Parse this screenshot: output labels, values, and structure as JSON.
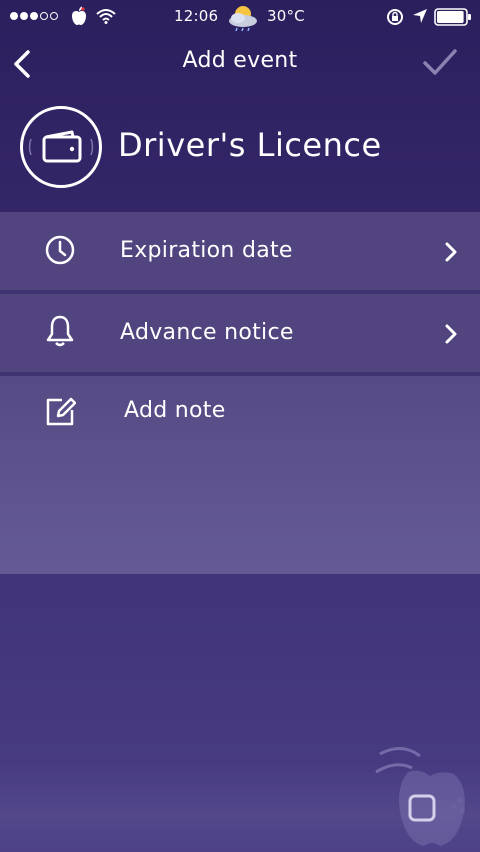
{
  "status_bar": {
    "time": "12:06",
    "temperature": "30°C",
    "signal_dots_filled": 3,
    "signal_dots_total": 5,
    "battery_level": 0.95,
    "icons": [
      "apple-icon",
      "wifi-icon",
      "weather-icon",
      "rotation-lock-icon",
      "location-arrow-icon",
      "battery-icon"
    ]
  },
  "nav": {
    "title": "Add event",
    "back_icon": "chevron-left-icon",
    "done_icon": "checkmark-icon"
  },
  "header": {
    "title": "Driver's Licence",
    "icon": "wallet-icon"
  },
  "rows": [
    {
      "label": "Expiration date",
      "icon": "clock-icon",
      "chevron": true
    },
    {
      "label": "Advance notice",
      "icon": "bell-icon",
      "chevron": true
    },
    {
      "label": "Add note",
      "icon": "edit-note-icon",
      "chevron": false
    }
  ],
  "colors": {
    "background_top": "#2c1f5e",
    "background_bottom": "#4a3d85",
    "row_background": "#52457f",
    "row_divider": "#3f3270",
    "text": "#ffffff",
    "done_disabled": "#8a82b0"
  }
}
